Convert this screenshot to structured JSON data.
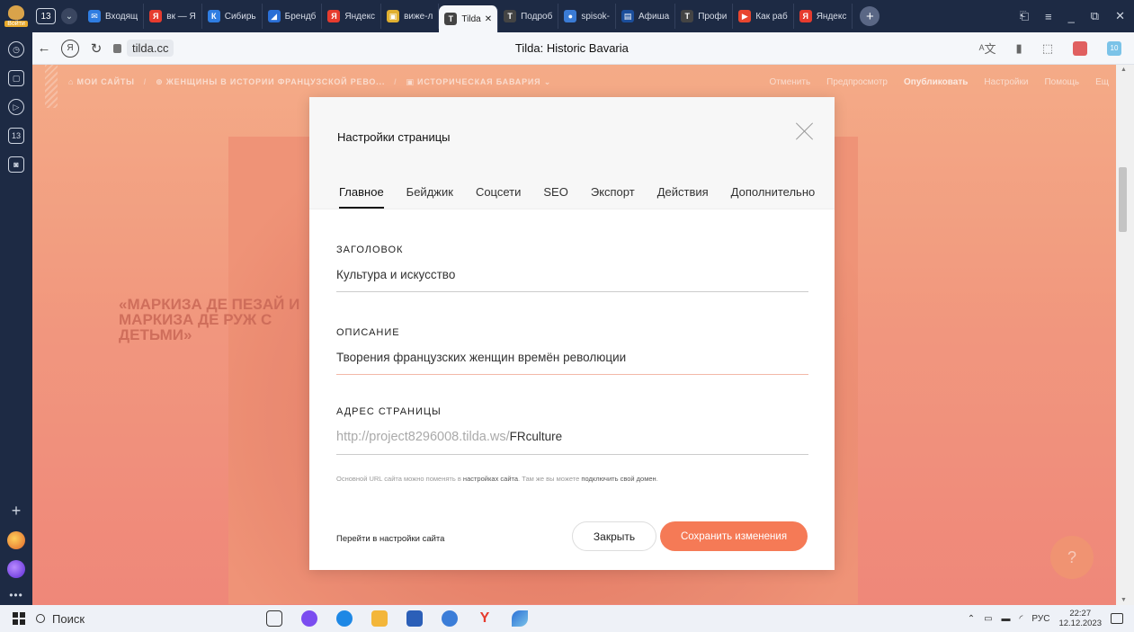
{
  "browser": {
    "profile_label": "Войти",
    "tab_count": "13",
    "tabs": [
      {
        "label": "Входящ",
        "color": "#2f7de1",
        "glyph": "✉"
      },
      {
        "label": "вк — Я",
        "color": "#e63b2e",
        "glyph": "Я"
      },
      {
        "label": "Сибирь",
        "color": "#2f7de1",
        "glyph": "К"
      },
      {
        "label": "Брендб",
        "color": "#2a6fd6",
        "glyph": "◢"
      },
      {
        "label": "Яндекс",
        "color": "#e63b2e",
        "glyph": "Я"
      },
      {
        "label": "виже-л",
        "color": "#e0b030",
        "glyph": "▣"
      },
      {
        "label": "Tilda",
        "color": "#444444",
        "glyph": "T",
        "active": true
      },
      {
        "label": "Подроб",
        "color": "#444444",
        "glyph": "T"
      },
      {
        "label": "spisok-",
        "color": "#3a7bd5",
        "glyph": "●"
      },
      {
        "label": "Афиша",
        "color": "#1b4e9b",
        "glyph": "▤"
      },
      {
        "label": "Профи",
        "color": "#444444",
        "glyph": "T"
      },
      {
        "label": "Как раб",
        "color": "#e8462f",
        "glyph": "▶"
      },
      {
        "label": "Яндекс",
        "color": "#e63b2e",
        "glyph": "Я"
      }
    ],
    "url": "tilda.cc",
    "page_title": "Tilda: Historic Bavaria",
    "ext_badge": "10"
  },
  "sidebar": {
    "num_badge": "13"
  },
  "editor": {
    "breadcrumb": {
      "sites": "МОИ САЙТЫ",
      "project": "ЖЕНЩИНЫ В ИСТОРИИ ФРАНЦУЗСКОЙ РЕВО...",
      "page": "ИСТОРИЧЕСКАЯ БАВАРИЯ"
    },
    "actions": {
      "undo": "Отменить",
      "preview": "Предпросмотр",
      "publish": "Опубликовать",
      "settings": "Настройки",
      "help": "Помощь",
      "more": "Ещ"
    },
    "bg_text": "«МАРКИЗА ДЕ ПЕЗАЙ И МАРКИЗА ДЕ РУЖ С ДЕТЬМИ»",
    "help_glyph": "?"
  },
  "modal": {
    "title": "Настройки страницы",
    "tabs": [
      "Главное",
      "Бейджик",
      "Соцсети",
      "SEO",
      "Экспорт",
      "Действия",
      "Дополнительно"
    ],
    "title_label": "ЗАГОЛОВОК",
    "title_value": "Культура и искусство",
    "desc_label": "ОПИСАНИЕ",
    "desc_value": "Творения французских женщин времён революции",
    "addr_label": "АДРЕС СТРАНИЦЫ",
    "addr_prefix": "http://project8296008.tilda.ws/",
    "addr_value": "FRculture",
    "hint_1": "Основной URL сайта можно поменять в",
    "hint_link1": "настройках сайта",
    "hint_2": ". Там же вы можете",
    "hint_link2": "подключить свой домен",
    "hint_3": ".",
    "goto_site": "Перейти в настройки сайта",
    "close_btn": "Закрыть",
    "save_btn": "Сохранить изменения"
  },
  "taskbar": {
    "search": "Поиск",
    "lang": "РУС",
    "time": "22:27",
    "date": "12.12.2023"
  }
}
